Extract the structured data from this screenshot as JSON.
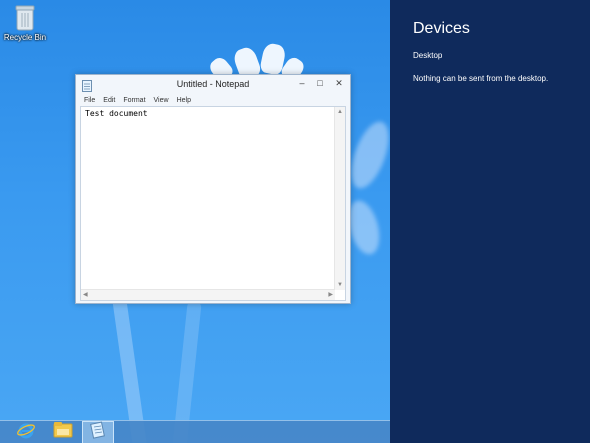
{
  "desktop": {
    "recycle_bin_label": "Recycle Bin"
  },
  "notepad": {
    "title": "Untitled - Notepad",
    "menu": [
      "File",
      "Edit",
      "Format",
      "View",
      "Help"
    ],
    "content": "Test document",
    "controls": {
      "minimize": "–",
      "maximize": "□",
      "close": "✕"
    }
  },
  "taskbar": {
    "items": [
      "internet-explorer-icon",
      "file-explorer-icon",
      "notepad-icon"
    ],
    "active_item": "notepad-icon"
  },
  "charm": {
    "title": "Devices",
    "subtitle": "Desktop",
    "message": "Nothing can be sent from the desktop.",
    "background_color": "#0f2a5c"
  },
  "colors": {
    "desktop_blue": "#2a8ae6",
    "charm_background": "#0f2a5c"
  }
}
